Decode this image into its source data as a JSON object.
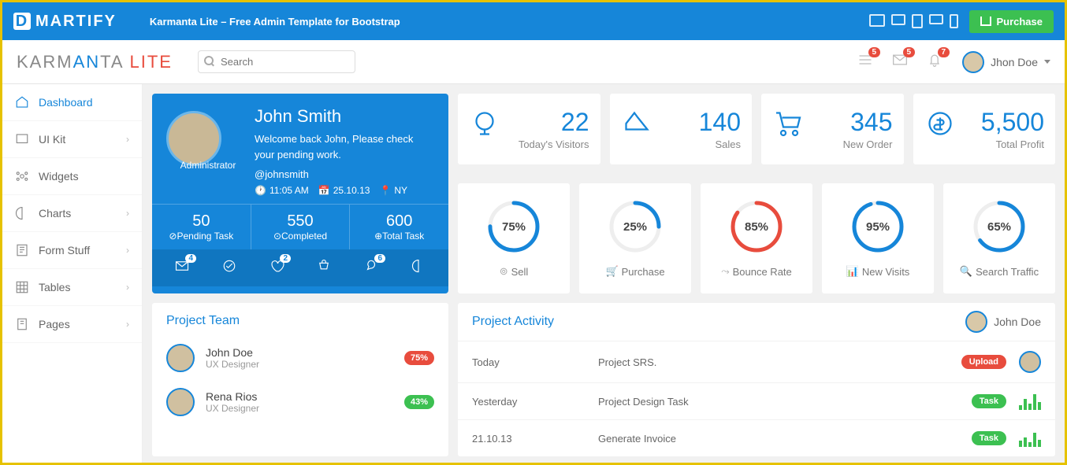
{
  "topbar": {
    "brand": "MARTIFY",
    "tagline": "Karmanta Lite – Free Admin Template for Bootstrap",
    "purchase": "Purchase"
  },
  "header": {
    "logo1": "KARM",
    "logo2": "AN",
    "logo3": "TA ",
    "logo4": "LITE",
    "search_ph": "Search",
    "notifs": [
      {
        "n": "5"
      },
      {
        "n": "5"
      },
      {
        "n": "7"
      }
    ],
    "user": "Jhon Doe"
  },
  "sidebar": [
    {
      "label": "Dashboard",
      "active": true,
      "chev": false
    },
    {
      "label": "UI Kit",
      "chev": true
    },
    {
      "label": "Widgets",
      "chev": false
    },
    {
      "label": "Charts",
      "chev": true
    },
    {
      "label": "Form Stuff",
      "chev": true
    },
    {
      "label": "Tables",
      "chev": true
    },
    {
      "label": "Pages",
      "chev": true
    }
  ],
  "profile": {
    "name": "John Smith",
    "welcome": "Welcome back John, Please check your pending work.",
    "handle": "@johnsmith",
    "role": "Administrator",
    "time": "11:05 AM",
    "date": "25.10.13",
    "loc": "NY",
    "stats": [
      {
        "n": "50",
        "l": "Pending Task"
      },
      {
        "n": "550",
        "l": "Completed"
      },
      {
        "n": "600",
        "l": "Total Task"
      }
    ],
    "icon_badges": [
      "4",
      "",
      "2",
      "",
      "6",
      ""
    ]
  },
  "kpis": [
    {
      "n": "22",
      "l": "Today's Visitors"
    },
    {
      "n": "140",
      "l": "Sales"
    },
    {
      "n": "345",
      "l": "New Order"
    },
    {
      "n": "5,500",
      "l": "Total Profit"
    }
  ],
  "rings": [
    {
      "pct": "75%",
      "v": 75,
      "l": "Sell",
      "c": "#1686d9"
    },
    {
      "pct": "25%",
      "v": 25,
      "l": "Purchase",
      "c": "#1686d9"
    },
    {
      "pct": "85%",
      "v": 85,
      "l": "Bounce Rate",
      "c": "#e84c3d"
    },
    {
      "pct": "95%",
      "v": 95,
      "l": "New Visits",
      "c": "#1686d9"
    },
    {
      "pct": "65%",
      "v": 65,
      "l": "Search Traffic",
      "c": "#1686d9"
    }
  ],
  "team": {
    "title": "Project Team",
    "members": [
      {
        "name": "John Doe",
        "role": "UX Designer",
        "pct": "75%",
        "c": "#e84c3d"
      },
      {
        "name": "Rena Rios",
        "role": "UX Designer",
        "pct": "43%",
        "c": "#3cc051"
      }
    ]
  },
  "activity": {
    "title": "Project Activity",
    "user": "John Doe",
    "rows": [
      {
        "when": "Today",
        "what": "Project SRS.",
        "tag": "Upload",
        "c": "#e84c3d",
        "av": true
      },
      {
        "when": "Yesterday",
        "what": "Project Design Task",
        "tag": "Task",
        "c": "#3cc051",
        "bars": [
          6,
          14,
          8,
          20,
          10
        ]
      },
      {
        "when": "21.10.13",
        "what": "Generate Invoice",
        "tag": "Task",
        "c": "#3cc051",
        "bars": [
          8,
          12,
          6,
          18,
          9
        ]
      }
    ]
  }
}
